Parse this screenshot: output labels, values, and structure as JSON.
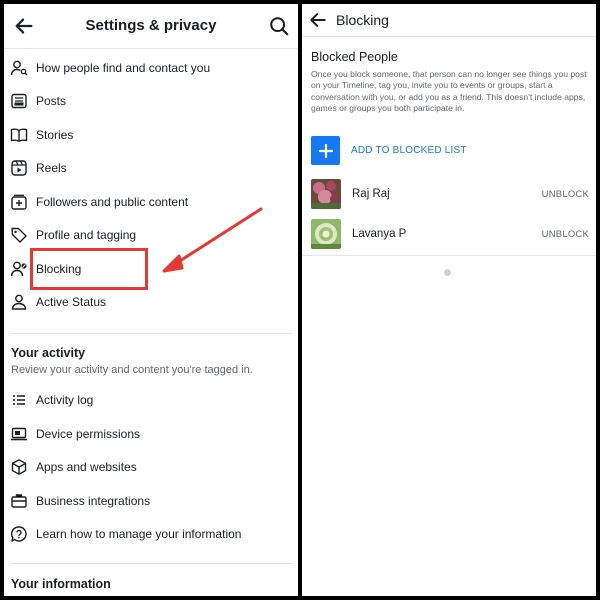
{
  "left": {
    "header": {
      "title": "Settings & privacy",
      "back_icon": "arrow-left-icon",
      "search_icon": "search-icon"
    },
    "items": [
      {
        "label": "How people find and contact you",
        "icon": "person-search-icon"
      },
      {
        "label": "Posts",
        "icon": "posts-icon"
      },
      {
        "label": "Stories",
        "icon": "book-icon"
      },
      {
        "label": "Reels",
        "icon": "reels-icon"
      },
      {
        "label": "Followers and public content",
        "icon": "followers-icon"
      },
      {
        "label": "Profile and tagging",
        "icon": "tag-icon"
      },
      {
        "label": "Blocking",
        "icon": "person-block-icon"
      },
      {
        "label": "Active Status",
        "icon": "person-status-icon"
      }
    ],
    "your_activity": {
      "title": "Your activity",
      "subtitle": "Review your activity and content you're tagged in.",
      "items": [
        {
          "label": "Activity log",
          "icon": "list-icon"
        },
        {
          "label": "Device permissions",
          "icon": "device-icon"
        },
        {
          "label": "Apps and websites",
          "icon": "cube-icon"
        },
        {
          "label": "Business integrations",
          "icon": "briefcase-icon"
        },
        {
          "label": "Learn how to manage your information",
          "icon": "chat-info-icon"
        }
      ]
    },
    "your_information": {
      "title": "Your information"
    },
    "annotation_color": "#e53935"
  },
  "right": {
    "header": {
      "title": "Blocking",
      "back_icon": "arrow-left-icon"
    },
    "blocked_people": {
      "title": "Blocked People",
      "description": "Once you block someone, that person can no longer see things you post on your Timeline, tag you, invite you to events or groups, start a conversation with you, or add you as a friend. This doesn't include apps, games or groups you both participate in.",
      "add_label": "ADD TO BLOCKED LIST",
      "people": [
        {
          "name": "Raj Raj",
          "action": "UNBLOCK"
        },
        {
          "name": "Lavanya P",
          "action": "UNBLOCK"
        }
      ]
    },
    "accent_color": "#1877f2"
  }
}
